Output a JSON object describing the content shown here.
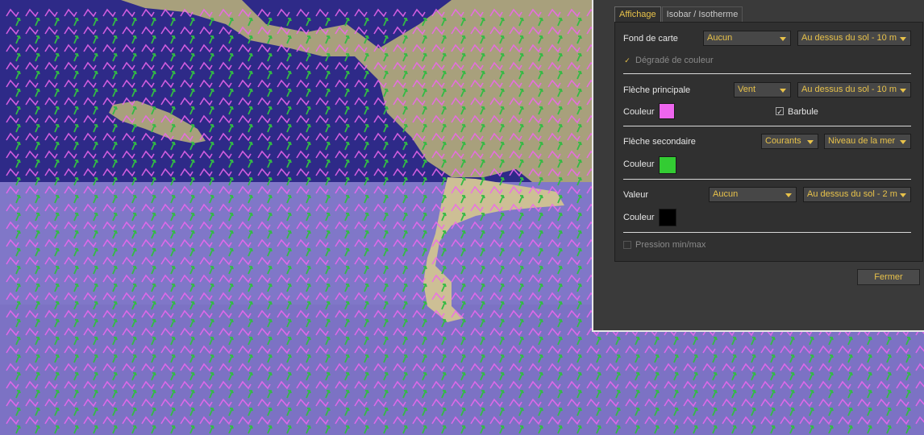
{
  "panel": {
    "tabs": [
      {
        "label": "Affichage",
        "active": true
      },
      {
        "label": "Isobar / Isotherme",
        "active": false
      }
    ],
    "fond_de_carte": {
      "label": "Fond de carte",
      "type_value": "Aucun",
      "level_value": "Au dessus du sol - 10 m",
      "gradient_label": "Dégradé de couleur",
      "gradient_checked": true
    },
    "fleche_principale": {
      "label": "Flèche principale",
      "type_value": "Vent",
      "level_value": "Au dessus du sol - 10 m",
      "color_label": "Couleur",
      "color": "#ee66ee",
      "barbule_label": "Barbule",
      "barbule_checked": true
    },
    "fleche_secondaire": {
      "label": "Flèche secondaire",
      "type_value": "Courants",
      "level_value": "Niveau de la mer",
      "color_label": "Couleur",
      "color": "#33cc33"
    },
    "valeur": {
      "label": "Valeur",
      "type_value": "Aucun",
      "level_value": "Au dessus du sol - 2 m",
      "color_label": "Couleur",
      "color": "#000000"
    },
    "pression": {
      "label": "Pression min/max",
      "checked": false,
      "enabled": false
    },
    "close_label": "Fermer"
  },
  "colors": {
    "accent": "#e8c24a",
    "sea_dark": "#2e2a88",
    "sea_light": "#7f77c9",
    "land": "#a8a07c",
    "wind_arrow": "#ee66ee",
    "current_arrow": "#33bb44"
  }
}
